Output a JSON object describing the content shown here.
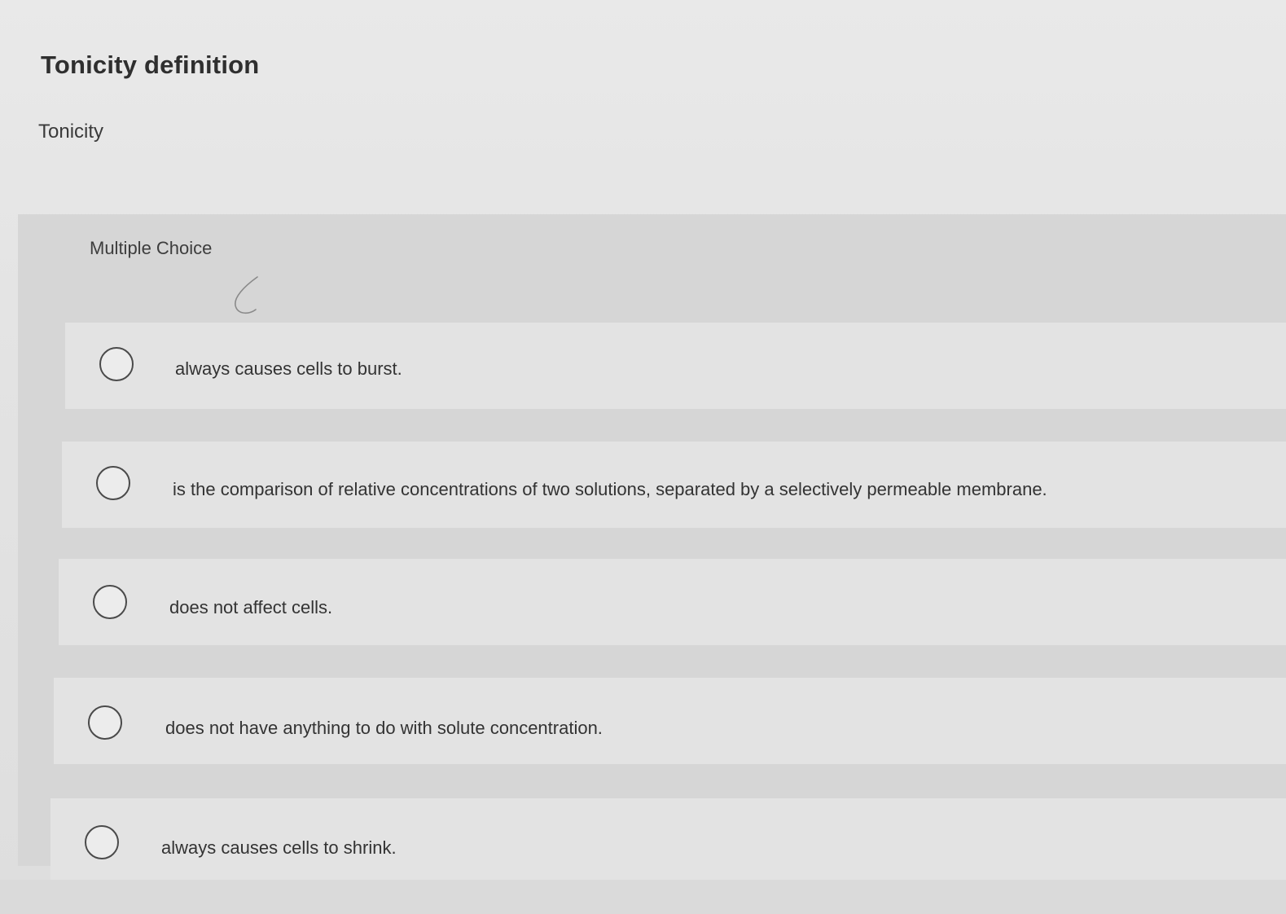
{
  "page": {
    "title": "Tonicity definition",
    "question": "Tonicity"
  },
  "question_type": "Multiple Choice",
  "options": [
    {
      "text": "always causes cells to burst."
    },
    {
      "text": "is the comparison of relative concentrations of two solutions, separated by a selectively permeable membrane."
    },
    {
      "text": "does not affect cells."
    },
    {
      "text": "does not have anything to do with solute concentration."
    },
    {
      "text": "always causes cells to shrink."
    }
  ],
  "colors": {
    "background": "#e4e4e4",
    "panel": "#d6d6d6",
    "option_row": "#e3e3e3",
    "text": "#333333"
  }
}
